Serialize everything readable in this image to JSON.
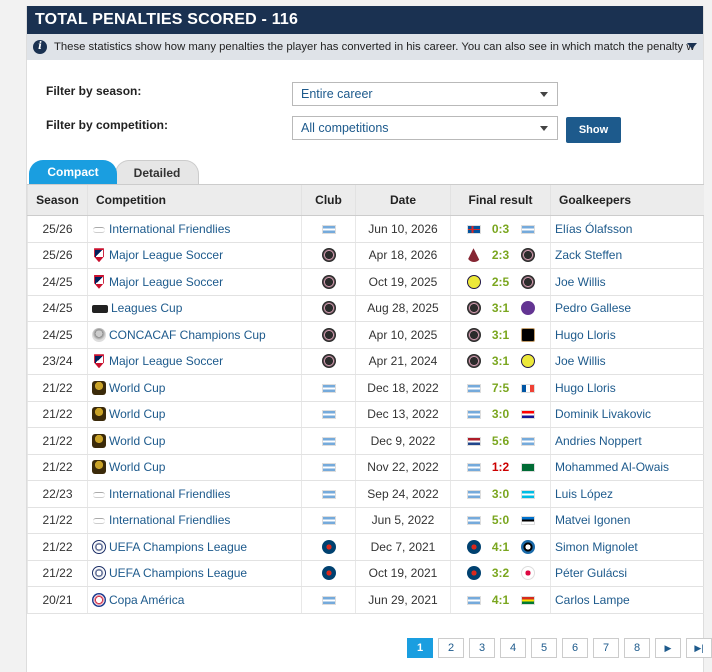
{
  "header": {
    "title": "TOTAL PENALTIES SCORED - 116"
  },
  "info": {
    "text": "These statistics show how many penalties the player has converted in his career. You can also see in which match the penalty was awarded, w..."
  },
  "filters": {
    "season_label": "Filter by season:",
    "season_value": "Entire career",
    "competition_label": "Filter by competition:",
    "competition_value": "All competitions",
    "show_label": "Show"
  },
  "tabs": {
    "compact": "Compact",
    "detailed": "Detailed"
  },
  "table": {
    "headers": {
      "season": "Season",
      "competition": "Competition",
      "club": "Club",
      "date": "Date",
      "result": "Final result",
      "goalkeepers": "Goalkeepers"
    },
    "rows": [
      {
        "season": "25/26",
        "competition": "International Friendlies",
        "comp_icon": "friendlies-icon",
        "club": "argentina-flag",
        "date": "Jun 10, 2026",
        "home": "iceland-flag",
        "score": "0:3",
        "outcome": "win",
        "away": "argentina-flag",
        "goalkeeper": "Elías Ólafsson"
      },
      {
        "season": "25/26",
        "competition": "Major League Soccer",
        "comp_icon": "mls-icon",
        "club": "inter-miami-crest",
        "date": "Apr 18, 2026",
        "home": "colorado-rapids-crest",
        "score": "2:3",
        "outcome": "win",
        "away": "inter-miami-crest",
        "goalkeeper": "Zack Steffen"
      },
      {
        "season": "24/25",
        "competition": "Major League Soccer",
        "comp_icon": "mls-icon",
        "club": "inter-miami-crest",
        "date": "Oct 19, 2025",
        "home": "nashville-crest",
        "score": "2:5",
        "outcome": "win",
        "away": "inter-miami-crest",
        "goalkeeper": "Joe Willis"
      },
      {
        "season": "24/25",
        "competition": "Leagues Cup",
        "comp_icon": "leagues-cup-icon",
        "club": "inter-miami-crest",
        "date": "Aug 28, 2025",
        "home": "inter-miami-crest",
        "score": "3:1",
        "outcome": "win",
        "away": "orlando-city-crest",
        "goalkeeper": "Pedro Gallese"
      },
      {
        "season": "24/25",
        "competition": "CONCACAF Champions Cup",
        "comp_icon": "concacaf-icon",
        "club": "inter-miami-crest",
        "date": "Apr 10, 2025",
        "home": "inter-miami-crest",
        "score": "3:1",
        "outcome": "win",
        "away": "lafc-crest",
        "goalkeeper": "Hugo Lloris"
      },
      {
        "season": "23/24",
        "competition": "Major League Soccer",
        "comp_icon": "mls-icon",
        "club": "inter-miami-crest",
        "date": "Apr 21, 2024",
        "home": "inter-miami-crest",
        "score": "3:1",
        "outcome": "win",
        "away": "nashville-crest",
        "goalkeeper": "Joe Willis"
      },
      {
        "season": "21/22",
        "competition": "World Cup",
        "comp_icon": "world-cup-icon",
        "club": "argentina-flag",
        "date": "Dec 18, 2022",
        "home": "argentina-flag",
        "score": "7:5",
        "outcome": "win",
        "away": "france-flag",
        "goalkeeper": "Hugo Lloris"
      },
      {
        "season": "21/22",
        "competition": "World Cup",
        "comp_icon": "world-cup-icon",
        "club": "argentina-flag",
        "date": "Dec 13, 2022",
        "home": "argentina-flag",
        "score": "3:0",
        "outcome": "win",
        "away": "croatia-flag",
        "goalkeeper": "Dominik Livakovic"
      },
      {
        "season": "21/22",
        "competition": "World Cup",
        "comp_icon": "world-cup-icon",
        "club": "argentina-flag",
        "date": "Dec 9, 2022",
        "home": "netherlands-flag",
        "score": "5:6",
        "outcome": "win",
        "away": "argentina-flag",
        "goalkeeper": "Andries Noppert"
      },
      {
        "season": "21/22",
        "competition": "World Cup",
        "comp_icon": "world-cup-icon",
        "club": "argentina-flag",
        "date": "Nov 22, 2022",
        "home": "argentina-flag",
        "score": "1:2",
        "outcome": "loss",
        "away": "saudi-arabia-flag",
        "goalkeeper": "Mohammed Al-Owais"
      },
      {
        "season": "22/23",
        "competition": "International Friendlies",
        "comp_icon": "friendlies-icon",
        "club": "argentina-flag",
        "date": "Sep 24, 2022",
        "home": "argentina-flag",
        "score": "3:0",
        "outcome": "win",
        "away": "honduras-flag",
        "goalkeeper": "Luis López"
      },
      {
        "season": "21/22",
        "competition": "International Friendlies",
        "comp_icon": "friendlies-icon",
        "club": "argentina-flag",
        "date": "Jun 5, 2022",
        "home": "argentina-flag",
        "score": "5:0",
        "outcome": "win",
        "away": "estonia-flag",
        "goalkeeper": "Matvei Igonen"
      },
      {
        "season": "21/22",
        "competition": "UEFA Champions League",
        "comp_icon": "ucl-icon",
        "club": "psg-crest",
        "date": "Dec 7, 2021",
        "home": "psg-crest",
        "score": "4:1",
        "outcome": "win",
        "away": "club-brugge-crest",
        "goalkeeper": "Simon Mignolet"
      },
      {
        "season": "21/22",
        "competition": "UEFA Champions League",
        "comp_icon": "ucl-icon",
        "club": "psg-crest",
        "date": "Oct 19, 2021",
        "home": "psg-crest",
        "score": "3:2",
        "outcome": "win",
        "away": "rb-leipzig-crest",
        "goalkeeper": "Péter Gulácsi"
      },
      {
        "season": "20/21",
        "competition": "Copa América",
        "comp_icon": "copa-america-icon",
        "club": "argentina-flag",
        "date": "Jun 29, 2021",
        "home": "argentina-flag",
        "score": "4:1",
        "outcome": "win",
        "away": "bolivia-flag",
        "goalkeeper": "Carlos Lampe"
      }
    ]
  },
  "pagination": {
    "pages": [
      "1",
      "2",
      "3",
      "4",
      "5",
      "6",
      "7",
      "8"
    ],
    "active": "1",
    "next": "▶",
    "last": "▶|"
  },
  "colors": {
    "header_bg": "#1a3151",
    "tab_active": "#1a9ee0",
    "link": "#1d5a8c",
    "win": "#7aa61f",
    "loss": "#cc0000"
  }
}
